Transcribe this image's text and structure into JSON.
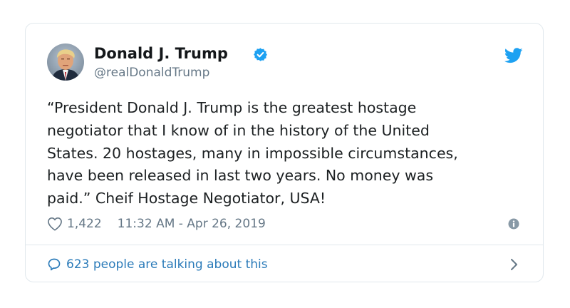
{
  "tweet": {
    "display_name": "Donald J. Trump",
    "handle": "@realDonaldTrump",
    "verified": true,
    "text": "“President Donald J. Trump is the greatest hostage\nnegotiator that I know of in the history of the United\nStates. 20 hostages, many in impossible circumstances,\nhave been released in last two years. No money was\npaid.” Cheif Hostage Negotiator, USA!",
    "like_count": "1,422",
    "timestamp": "11:32 AM - Apr 26, 2019",
    "talking_text": "623 people are talking about this"
  },
  "icons": {
    "verified": "verified-badge-icon",
    "brand": "twitter-bird-icon",
    "like": "heart-icon",
    "info": "info-icon",
    "reply": "comment-bubble-icon",
    "more": "chevron-right-icon"
  },
  "colors": {
    "brand_blue": "#1da1f2",
    "link_blue": "#2b7bb9",
    "text_primary": "#1c2022",
    "text_secondary": "#657786",
    "border": "#e1e8ed"
  }
}
